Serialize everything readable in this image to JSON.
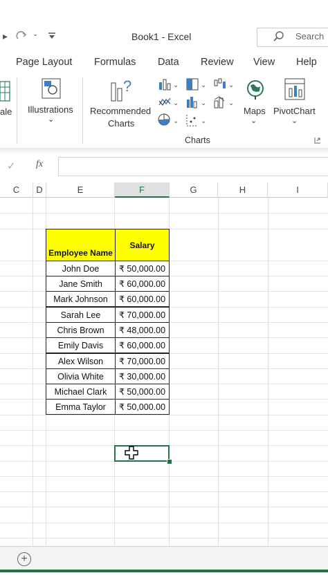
{
  "title_bar": {
    "title": "Book1  -  Excel",
    "search_placeholder": "Search"
  },
  "menu": {
    "tabs": [
      "Page Layout",
      "Formulas",
      "Data",
      "Review",
      "View",
      "Help"
    ]
  },
  "ribbon": {
    "truncated_label": "ale",
    "illustrations_label": "Illustrations",
    "recommended_line1": "Recommended",
    "recommended_line2": "Charts",
    "maps_label": "Maps",
    "pivotchart_label": "PivotChart",
    "group_label": "Charts"
  },
  "formula_bar": {
    "fx_label": "fx",
    "value": ""
  },
  "grid": {
    "columns": [
      "C",
      "D",
      "E",
      "F",
      "G",
      "H",
      "I"
    ],
    "selected_column": "F"
  },
  "table": {
    "headers": [
      "Employee Name",
      "Salary"
    ],
    "rows": [
      {
        "name": "John Doe",
        "salary": "₹ 50,000.00"
      },
      {
        "name": "Jane Smith",
        "salary": "₹ 60,000.00"
      },
      {
        "name": "Mark Johnson",
        "salary": "₹ 60,000.00"
      },
      {
        "name": "Sarah Lee",
        "salary": "₹ 70,000.00"
      },
      {
        "name": "Chris Brown",
        "salary": "₹ 48,000.00"
      },
      {
        "name": "Emily Davis",
        "salary": "₹ 60,000.00"
      },
      {
        "name": "Alex Wilson",
        "salary": "₹ 70,000.00"
      },
      {
        "name": "Olivia White",
        "salary": "₹ 30,000.00"
      },
      {
        "name": "Michael Clark",
        "salary": "₹ 50,000.00"
      },
      {
        "name": "Emma Taylor",
        "salary": "₹ 50,000.00"
      }
    ]
  },
  "colors": {
    "excel_green": "#217346",
    "header_fill": "#ffff00"
  }
}
